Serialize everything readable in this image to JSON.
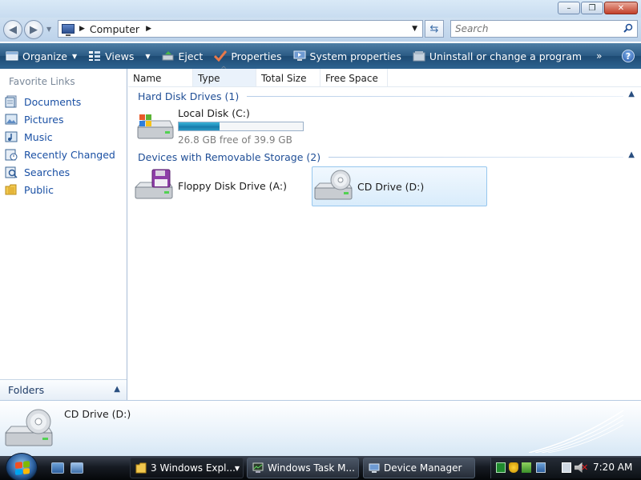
{
  "address": {
    "location": "Computer"
  },
  "search": {
    "placeholder": "Search"
  },
  "toolbar": {
    "organize": "Organize",
    "views": "Views",
    "eject": "Eject",
    "properties": "Properties",
    "system_properties": "System properties",
    "uninstall": "Uninstall or change a program",
    "more": "»",
    "help": "?"
  },
  "navpane": {
    "heading": "Favorite Links",
    "items": [
      {
        "label": "Documents",
        "icon": "documents-icon"
      },
      {
        "label": "Pictures",
        "icon": "pictures-icon"
      },
      {
        "label": "Music",
        "icon": "music-icon"
      },
      {
        "label": "Recently Changed",
        "icon": "recently-changed-icon"
      },
      {
        "label": "Searches",
        "icon": "searches-icon"
      },
      {
        "label": "Public",
        "icon": "public-folder-icon"
      }
    ],
    "folders": "Folders"
  },
  "columns": [
    "Name",
    "Type",
    "Total Size",
    "Free Space"
  ],
  "groups": {
    "hdd": "Hard Disk Drives (1)",
    "removable": "Devices with Removable Storage (2)"
  },
  "drives": {
    "c": {
      "name": "Local Disk (C:)",
      "free": "26.8 GB free of 39.9 GB",
      "used_fraction": 0.33
    },
    "a": {
      "name": "Floppy Disk Drive (A:)"
    },
    "d": {
      "name": "CD Drive (D:)"
    }
  },
  "details": {
    "name": "CD Drive (D:)"
  },
  "taskbar": {
    "tasks": [
      "3 Windows Expl...",
      "Windows Task M...",
      "Device Manager"
    ],
    "clock": "7:20 AM"
  },
  "colors": {
    "accent": "#1f4e96",
    "link": "#1a50a4",
    "cmdbar": "#2a5a84"
  }
}
